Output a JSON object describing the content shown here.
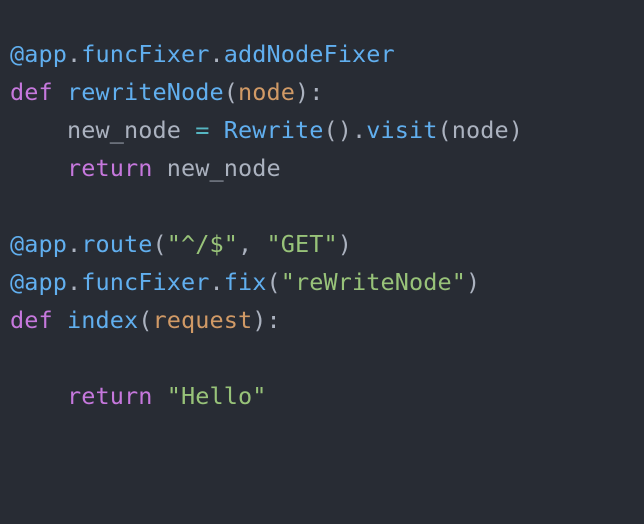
{
  "colors": {
    "background": "#282c34",
    "decorator": "#61afef",
    "keyword": "#c678dd",
    "function": "#61afef",
    "parameter": "#d19a66",
    "identifier": "#abb2bf",
    "operator": "#56b6c2",
    "string": "#98c379"
  },
  "code": {
    "lines": [
      [
        {
          "t": "@app",
          "k": "decorator"
        },
        {
          "t": ".",
          "k": "punct"
        },
        {
          "t": "funcFixer",
          "k": "decorator"
        },
        {
          "t": ".",
          "k": "punct"
        },
        {
          "t": "addNodeFixer",
          "k": "decorator"
        }
      ],
      [
        {
          "t": "def",
          "k": "keyword"
        },
        {
          "t": " ",
          "k": "ident"
        },
        {
          "t": "rewriteNode",
          "k": "funcname"
        },
        {
          "t": "(",
          "k": "punct"
        },
        {
          "t": "node",
          "k": "param"
        },
        {
          "t": "):",
          "k": "punct"
        }
      ],
      [
        {
          "t": "    new_node ",
          "k": "ident"
        },
        {
          "t": "=",
          "k": "op"
        },
        {
          "t": " ",
          "k": "ident"
        },
        {
          "t": "Rewrite",
          "k": "call"
        },
        {
          "t": "().",
          "k": "punct"
        },
        {
          "t": "visit",
          "k": "call"
        },
        {
          "t": "(node)",
          "k": "punct"
        }
      ],
      [
        {
          "t": "    ",
          "k": "ident"
        },
        {
          "t": "return",
          "k": "keyword"
        },
        {
          "t": " new_node",
          "k": "ident"
        }
      ],
      [],
      [
        {
          "t": "@app",
          "k": "decorator"
        },
        {
          "t": ".",
          "k": "punct"
        },
        {
          "t": "route",
          "k": "decorator"
        },
        {
          "t": "(",
          "k": "punct"
        },
        {
          "t": "\"^/$\"",
          "k": "string"
        },
        {
          "t": ", ",
          "k": "punct"
        },
        {
          "t": "\"GET\"",
          "k": "string"
        },
        {
          "t": ")",
          "k": "punct"
        }
      ],
      [
        {
          "t": "@app",
          "k": "decorator"
        },
        {
          "t": ".",
          "k": "punct"
        },
        {
          "t": "funcFixer",
          "k": "decorator"
        },
        {
          "t": ".",
          "k": "punct"
        },
        {
          "t": "fix",
          "k": "decorator"
        },
        {
          "t": "(",
          "k": "punct"
        },
        {
          "t": "\"reWriteNode\"",
          "k": "string"
        },
        {
          "t": ")",
          "k": "punct"
        }
      ],
      [
        {
          "t": "def",
          "k": "keyword"
        },
        {
          "t": " ",
          "k": "ident"
        },
        {
          "t": "index",
          "k": "funcname"
        },
        {
          "t": "(",
          "k": "punct"
        },
        {
          "t": "request",
          "k": "param"
        },
        {
          "t": "):",
          "k": "punct"
        }
      ],
      [],
      [
        {
          "t": "    ",
          "k": "ident"
        },
        {
          "t": "return",
          "k": "keyword"
        },
        {
          "t": " ",
          "k": "ident"
        },
        {
          "t": "\"Hello\"",
          "k": "string"
        }
      ]
    ]
  }
}
